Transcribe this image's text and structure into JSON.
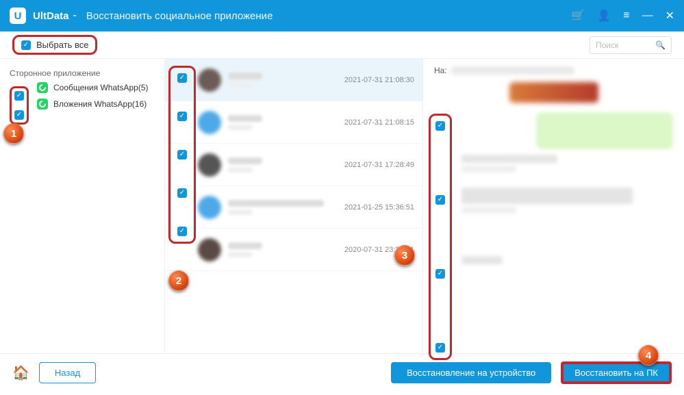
{
  "titlebar": {
    "app": "UltData",
    "subtitle": "Восстановить социальное приложение"
  },
  "toprow": {
    "select_all": "Выбрать все",
    "search_placeholder": "Поиск"
  },
  "sidebar": {
    "heading": "Сторонное приложение",
    "items": [
      {
        "label": "Сообщения WhatsApp(5)"
      },
      {
        "label": "Вложения WhatsApp(16)"
      }
    ]
  },
  "conversations": [
    {
      "time": "2021-07-31 21:08:30",
      "avatar": "#6b5a55",
      "selected": true
    },
    {
      "time": "2021-07-31 21:08:15",
      "avatar": "#4da9e8",
      "selected": false
    },
    {
      "time": "2021-07-31 17:28:49",
      "avatar": "#555",
      "selected": false
    },
    {
      "time": "2021-01-25 15:36:51",
      "avatar": "#4da9e8",
      "selected": false,
      "wide": true
    },
    {
      "time": "2020-07-31 23:21:21",
      "avatar": "#5a4a45",
      "selected": false
    }
  ],
  "detail": {
    "to_label": "На:"
  },
  "footer": {
    "back": "Назад",
    "restore_device": "Восстановление на устройство",
    "restore_pc": "Восстановить на ПК"
  },
  "markers": [
    "1",
    "2",
    "3",
    "4"
  ]
}
